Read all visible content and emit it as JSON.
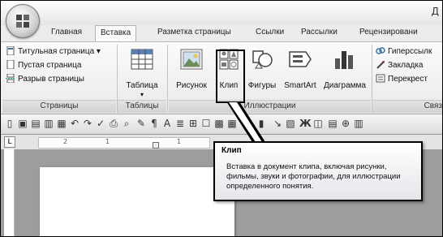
{
  "window": {
    "title_fragment": "Д"
  },
  "tabs": [
    {
      "label": "Главная"
    },
    {
      "label": "Вставка"
    },
    {
      "label": "Разметка страницы"
    },
    {
      "label": "Ссылки"
    },
    {
      "label": "Рассылки"
    },
    {
      "label": "Рецензировани"
    }
  ],
  "active_tab": "Вставка",
  "ribbon": {
    "pages": {
      "title_page": "Титульная страница",
      "blank_page": "Пустая страница",
      "page_break": "Разрыв страницы",
      "group_label": "Страницы"
    },
    "tables": {
      "table": "Таблица",
      "group_label": "Таблицы"
    },
    "illustrations": {
      "picture": "Рисунок",
      "clip": "Клип",
      "shapes": "Фигуры",
      "smartart": "SmartArt",
      "chart": "Диаграмма",
      "group_label": "Иллюстрации"
    },
    "links": {
      "hyperlink": "Гиперссылк",
      "bookmark": "Закладка",
      "crossref": "Перекрест",
      "group_label": "Связ"
    }
  },
  "ruler": {
    "numbers": [
      "2",
      "1",
      "1"
    ]
  },
  "tooltip": {
    "title": "Клип",
    "body": "Вставка в документ клипа, включая рисунки, фильмы, звуки и фотографии, для иллюстрации определенного понятия."
  },
  "colors": {
    "highlight_border": "#000000",
    "ribbon_bg": "#f2f2f2"
  }
}
